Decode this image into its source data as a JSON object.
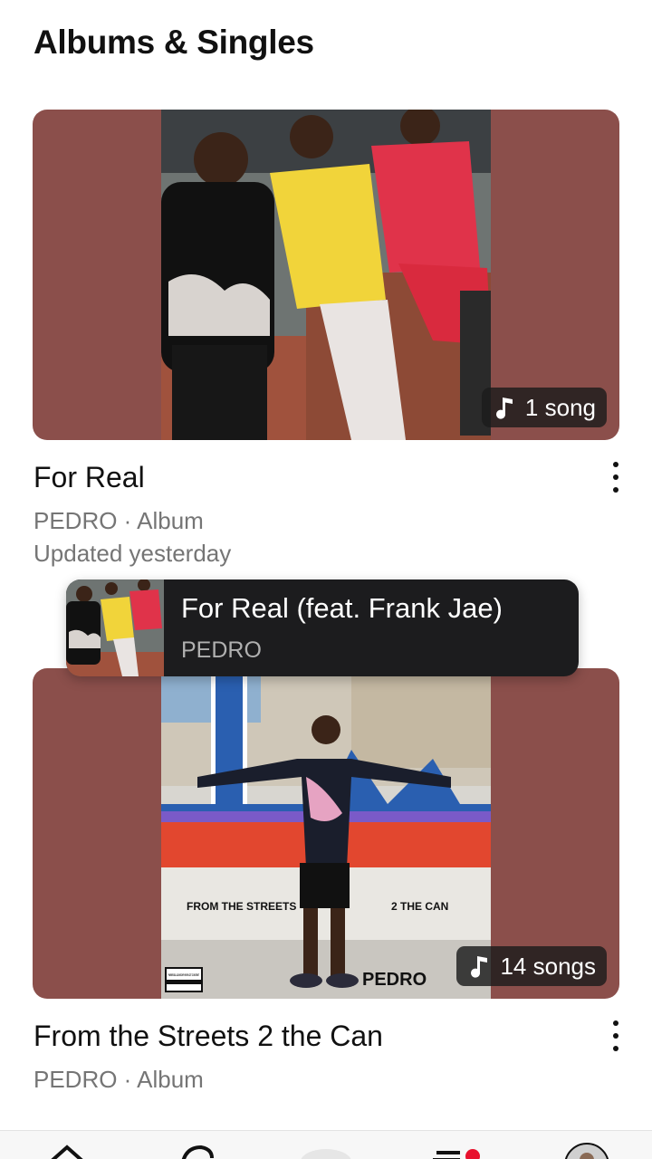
{
  "header": {
    "title": "Albums & Singles"
  },
  "albums": [
    {
      "title": "For Real",
      "meta": "PEDRO · Album",
      "updated": "Updated yesterday",
      "song_count": "1 song",
      "background_color": "#8b4f4b"
    },
    {
      "title": "From the Streets 2 the Can",
      "meta": "PEDRO · Album",
      "song_count": "14 songs",
      "background_color": "#8b4f4b",
      "cover_text": {
        "left": "FROM THE STREETS",
        "right": "2 THE CAN",
        "artist": "PEDRO",
        "advisory": "PARENTAL ADVISORY EXPLICIT CONTENT"
      }
    }
  ],
  "mini_player": {
    "title": "For Real (feat. Frank Jae)",
    "artist": "PEDRO"
  },
  "tab_bar": {
    "tabs": [
      "home-icon",
      "search-icon",
      "now-playing-icon",
      "library-icon",
      "profile-avatar"
    ]
  }
}
